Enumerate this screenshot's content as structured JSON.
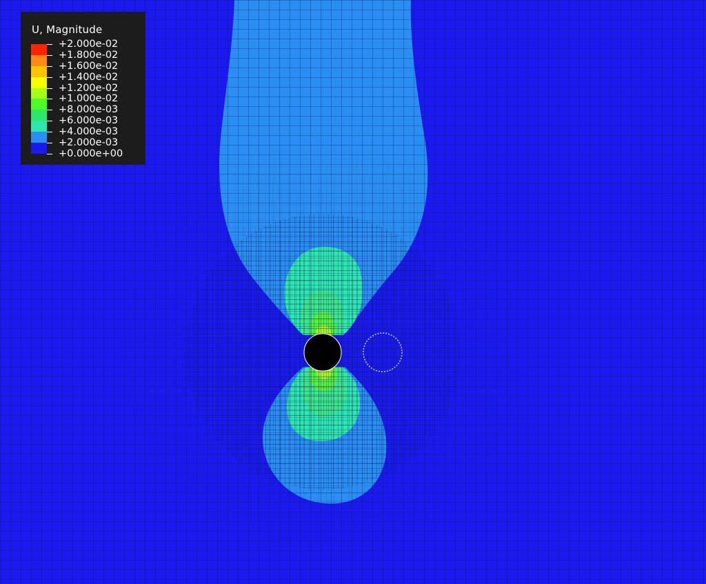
{
  "legend": {
    "title": "U, Magnitude",
    "entries": [
      {
        "value": "+2.000e-02",
        "color": "#ff2400"
      },
      {
        "value": "+1.800e-02",
        "color": "#ff8a14"
      },
      {
        "value": "+1.600e-02",
        "color": "#ffc400"
      },
      {
        "value": "+1.400e-02",
        "color": "#f5ff00"
      },
      {
        "value": "+1.200e-02",
        "color": "#a6ff1a"
      },
      {
        "value": "+1.000e-02",
        "color": "#4cff24"
      },
      {
        "value": "+8.000e-03",
        "color": "#2ee66a"
      },
      {
        "value": "+6.000e-03",
        "color": "#2ee6b0"
      },
      {
        "value": "+4.000e-03",
        "color": "#20e2f0"
      },
      {
        "value": "+2.000e-03",
        "color": "#2a8ef2"
      },
      {
        "value": "+0.000e+00",
        "color": "#1a1aee"
      }
    ]
  },
  "colors": {
    "background": "#1a1aee",
    "band_2e-03": "#2a8ef2",
    "band_4e-03": "#2ce0e2",
    "band_6e-03": "#2ee6b0",
    "band_8e-03": "#3ce68a",
    "band_1e-02": "#56f040",
    "band_1.2e-02": "#a6f52a",
    "mesh_lines": "#101050",
    "hole": "#000000",
    "ghost_circle": "#c8c8d8"
  }
}
